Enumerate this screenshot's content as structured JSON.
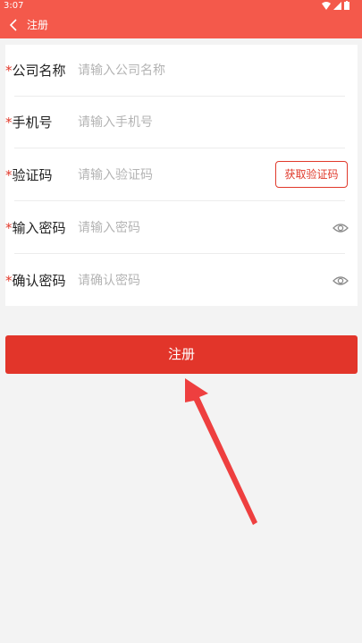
{
  "status_bar": {
    "time": "3:07"
  },
  "header": {
    "title": "注册"
  },
  "form": {
    "rows": [
      {
        "required_mark": "*",
        "label": "公司名称",
        "placeholder": "请输入公司名称"
      },
      {
        "required_mark": "*",
        "label": "手机号",
        "placeholder": "请输入手机号"
      },
      {
        "required_mark": "*",
        "label": "验证码",
        "placeholder": "请输入验证码",
        "action": "获取验证码"
      },
      {
        "required_mark": "*",
        "label": "输入密码",
        "placeholder": "请输入密码",
        "icon": "eye-icon"
      },
      {
        "required_mark": "*",
        "label": "确认密码",
        "placeholder": "请确认密码",
        "icon": "eye-icon"
      }
    ]
  },
  "submit_label": "注册",
  "colors": {
    "header": "#f4594b",
    "accent": "#e2352a",
    "required": "#e0392b"
  }
}
